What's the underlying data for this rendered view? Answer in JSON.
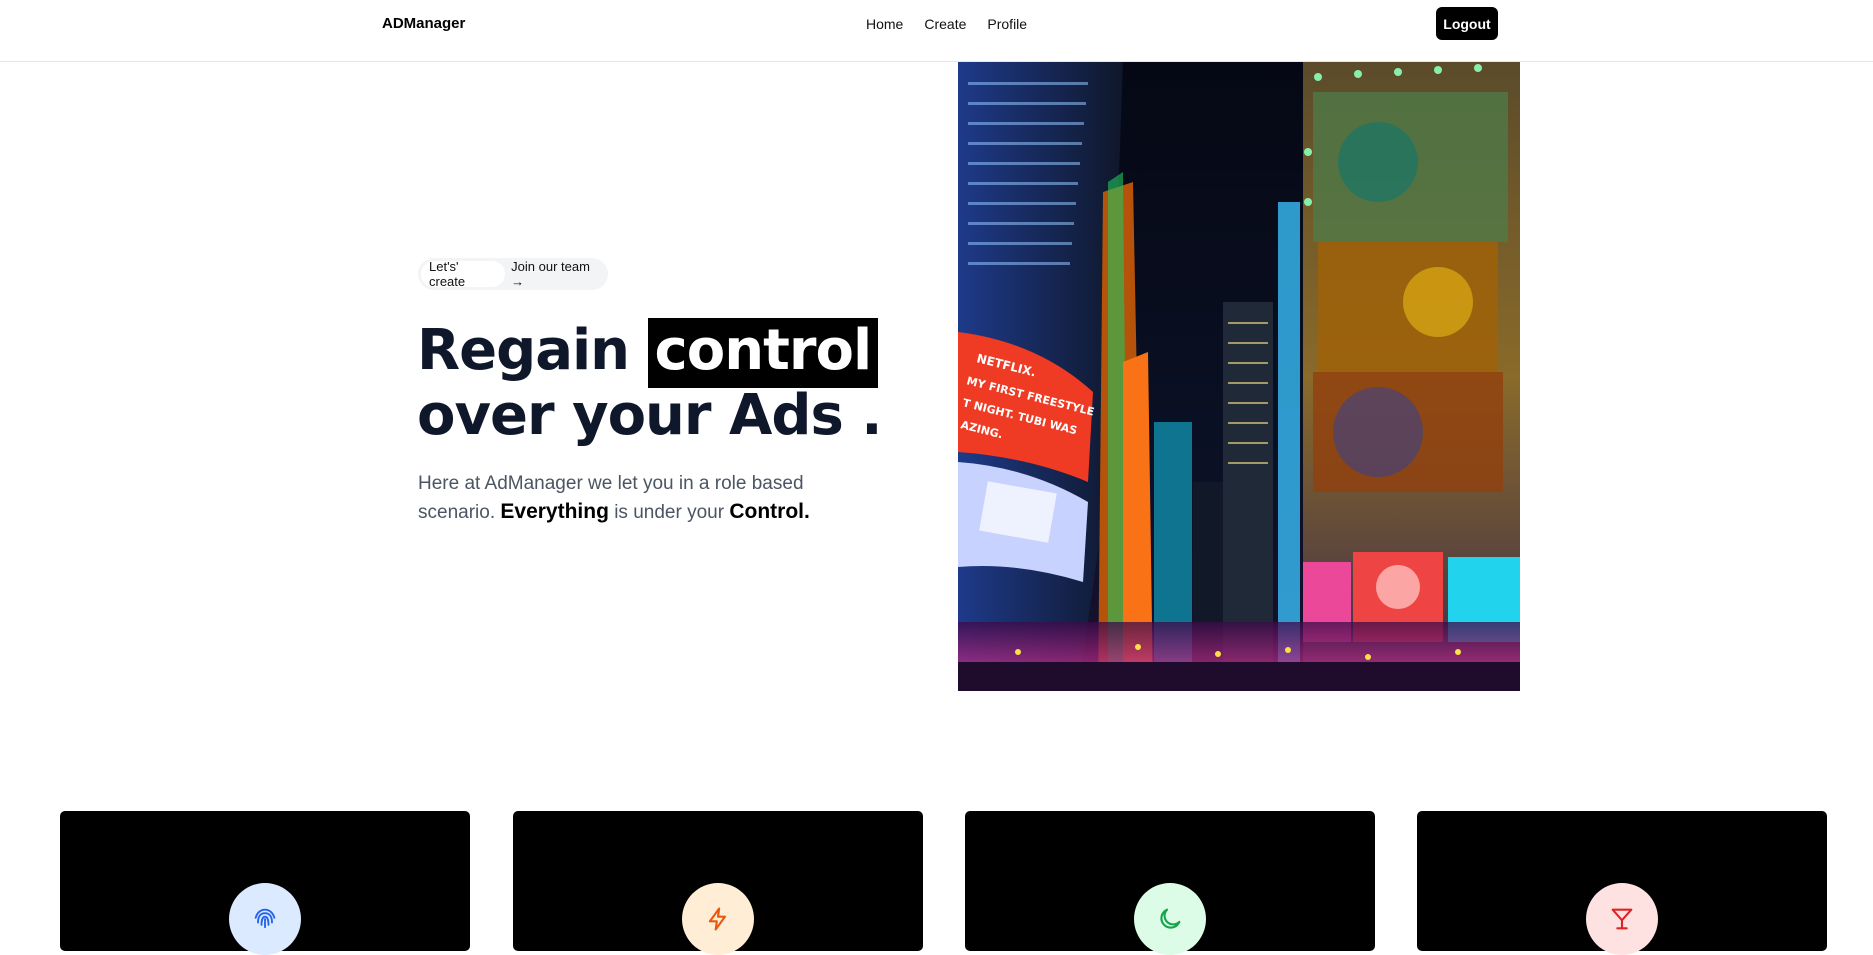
{
  "nav": {
    "brand": "ADManager",
    "links": [
      "Home",
      "Create",
      "Profile"
    ],
    "logout_label": "Logout"
  },
  "hero": {
    "pill_tag": "Let's' create",
    "pill_link": "Join our team →",
    "headline_part1": "Regain",
    "headline_highlight": "control",
    "headline_line2": "over your Ads .",
    "desc_part1": "Here at AdManager we let you in a role based scenario.",
    "desc_bold1": "Everything",
    "desc_part2": "is under your",
    "desc_bold2": "Control.",
    "image_alt": "Times Square at night with neon billboards"
  },
  "features": [
    {
      "icon": "fingerprint-icon",
      "color": "#dbeafe",
      "stroke": "#2563eb"
    },
    {
      "icon": "bolt-icon",
      "color": "#ffedd5",
      "stroke": "#ea580c"
    },
    {
      "icon": "moon-icon",
      "color": "#dcfce7",
      "stroke": "#16a34a"
    },
    {
      "icon": "cocktail-icon",
      "color": "#fee2e2",
      "stroke": "#dc2626"
    }
  ]
}
